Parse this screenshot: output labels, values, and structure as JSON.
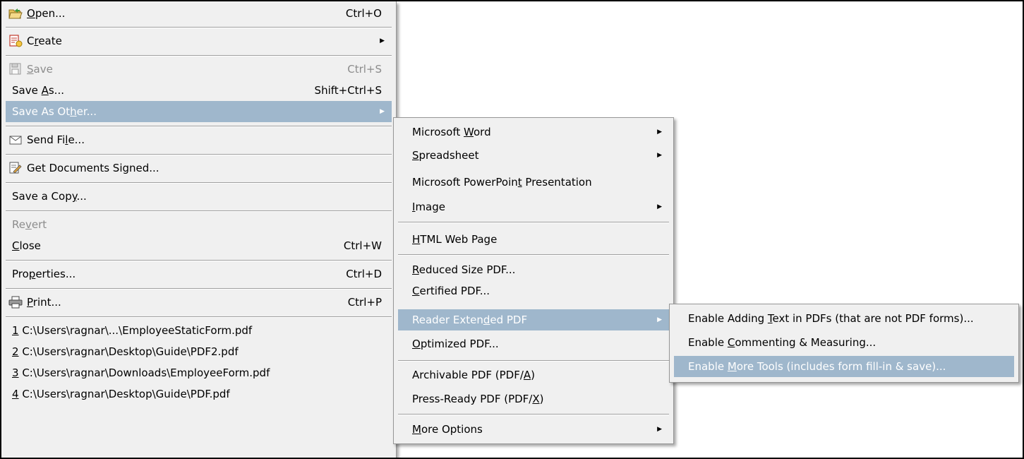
{
  "file_menu": {
    "items": [
      {
        "pre": "",
        "acc": "O",
        "post": "pen...",
        "shortcut": "Ctrl+O",
        "icon": "folder-open-icon"
      },
      {
        "pre": "C",
        "acc": "r",
        "post": "eate",
        "shortcut": "",
        "icon": "create-pdf-icon"
      },
      {
        "pre": "",
        "acc": "S",
        "post": "ave",
        "shortcut": "Ctrl+S",
        "icon": "save-disk-icon",
        "disabled": true
      },
      {
        "pre": "Save ",
        "acc": "A",
        "post": "s...",
        "shortcut": "Shift+Ctrl+S"
      },
      {
        "pre": "Save As Ot",
        "acc": "h",
        "post": "er...",
        "shortcut": ""
      },
      {
        "pre": "Send Fi",
        "acc": "l",
        "post": "e...",
        "shortcut": "",
        "icon": "envelope-icon"
      },
      {
        "pre": "Get Documents Signed...",
        "acc": "",
        "post": "",
        "shortcut": "",
        "icon": "sign-document-icon"
      },
      {
        "pre": "Save a Cop",
        "acc": "y",
        "post": "...",
        "shortcut": ""
      },
      {
        "pre": "Re",
        "acc": "v",
        "post": "ert",
        "shortcut": "",
        "disabled": true
      },
      {
        "pre": "",
        "acc": "C",
        "post": "lose",
        "shortcut": "Ctrl+W"
      },
      {
        "pre": "Pro",
        "acc": "p",
        "post": "erties...",
        "shortcut": "Ctrl+D"
      },
      {
        "pre": "",
        "acc": "P",
        "post": "rint...",
        "shortcut": "Ctrl+P",
        "icon": "printer-icon"
      },
      {
        "pre": "",
        "acc": "1",
        "post": " C:\\Users\\ragnar\\...\\EmployeeStaticForm.pdf",
        "shortcut": ""
      },
      {
        "pre": "",
        "acc": "2",
        "post": " C:\\Users\\ragnar\\Desktop\\Guide\\PDF2.pdf",
        "shortcut": ""
      },
      {
        "pre": "",
        "acc": "3",
        "post": " C:\\Users\\ragnar\\Downloads\\EmployeeForm.pdf",
        "shortcut": ""
      },
      {
        "pre": "",
        "acc": "4",
        "post": " C:\\Users\\ragnar\\Desktop\\Guide\\PDF.pdf",
        "shortcut": ""
      }
    ]
  },
  "save_as_other_menu": {
    "items": [
      {
        "pre": "Microsoft ",
        "acc": "W",
        "post": "ord"
      },
      {
        "pre": "",
        "acc": "S",
        "post": "preadsheet"
      },
      {
        "pre": "Microsoft PowerPoin",
        "acc": "t",
        "post": " Presentation"
      },
      {
        "pre": "",
        "acc": "I",
        "post": "mage"
      },
      {
        "pre": "",
        "acc": "H",
        "post": "TML Web Page"
      },
      {
        "pre": "",
        "acc": "R",
        "post": "educed Size PDF..."
      },
      {
        "pre": "",
        "acc": "C",
        "post": "ertified PDF..."
      },
      {
        "pre": "Reader Exten",
        "acc": "d",
        "post": "ed PDF"
      },
      {
        "pre": "",
        "acc": "O",
        "post": "ptimized PDF..."
      },
      {
        "pre": "Archivable PDF (PDF/",
        "acc": "A",
        "post": ")"
      },
      {
        "pre": "Press-Ready PDF (PDF/",
        "acc": "X",
        "post": ")"
      },
      {
        "pre": "",
        "acc": "M",
        "post": "ore Options"
      }
    ]
  },
  "reader_extended_menu": {
    "items": [
      {
        "pre": "Enable Adding ",
        "acc": "T",
        "post": "ext in PDFs (that are not PDF forms)..."
      },
      {
        "pre": "Enable ",
        "acc": "C",
        "post": "ommenting & Measuring..."
      },
      {
        "pre": "Enable ",
        "acc": "M",
        "post": "ore Tools (includes form fill-in & save)..."
      }
    ]
  },
  "colors": {
    "highlight": "#9fb7cc",
    "menu_bg": "#f0f0f0",
    "disabled_text": "#8c8c8c"
  }
}
